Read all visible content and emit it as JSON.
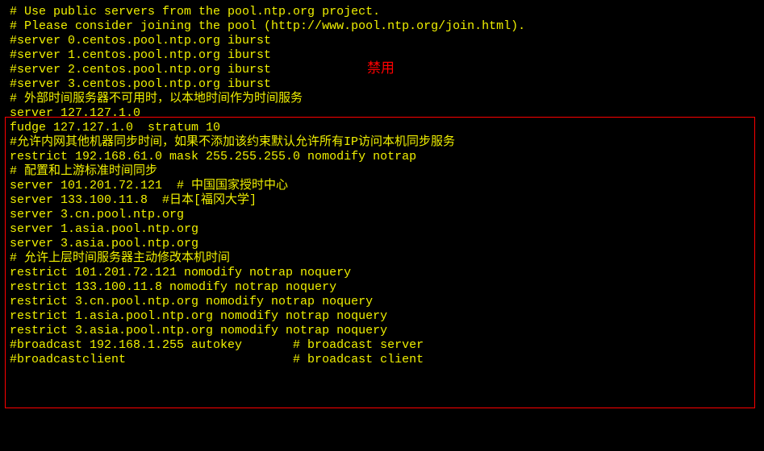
{
  "annotation": "禁用",
  "lines": {
    "l1": "# Use public servers from the pool.ntp.org project.",
    "l2": "# Please consider joining the pool (http://www.pool.ntp.org/join.html).",
    "l3": "#server 0.centos.pool.ntp.org iburst",
    "l4": "#server 1.centos.pool.ntp.org iburst",
    "l5": "#server 2.centos.pool.ntp.org iburst",
    "l6": "#server 3.centos.pool.ntp.org iburst",
    "l7": "",
    "l8": "# 外部时间服务器不可用时，以本地时间作为时间服务",
    "l9": "server 127.127.1.0",
    "l10": "fudge 127.127.1.0  stratum 10",
    "l11": "#允许内网其他机器同步时间，如果不添加该约束默认允许所有IP访问本机同步服务",
    "l12": "restrict 192.168.61.0 mask 255.255.255.0 nomodify notrap",
    "l13": "# 配置和上游标准时间同步",
    "l14": "server 101.201.72.121  # 中国国家授时中心",
    "l15": "server 133.100.11.8  #日本[福冈大学]",
    "l16": "server 3.cn.pool.ntp.org",
    "l17": "server 1.asia.pool.ntp.org",
    "l18": "server 3.asia.pool.ntp.org",
    "l19": "# 允许上层时间服务器主动修改本机时间",
    "l20": "restrict 101.201.72.121 nomodify notrap noquery",
    "l21": "restrict 133.100.11.8 nomodify notrap noquery",
    "l22": "restrict 3.cn.pool.ntp.org nomodify notrap noquery",
    "l23": "restrict 1.asia.pool.ntp.org nomodify notrap noquery",
    "l24": "restrict 3.asia.pool.ntp.org nomodify notrap noquery",
    "l25": "",
    "l26": "#broadcast 192.168.1.255 autokey       # broadcast server",
    "l27": "#broadcastclient                       # broadcast client"
  }
}
